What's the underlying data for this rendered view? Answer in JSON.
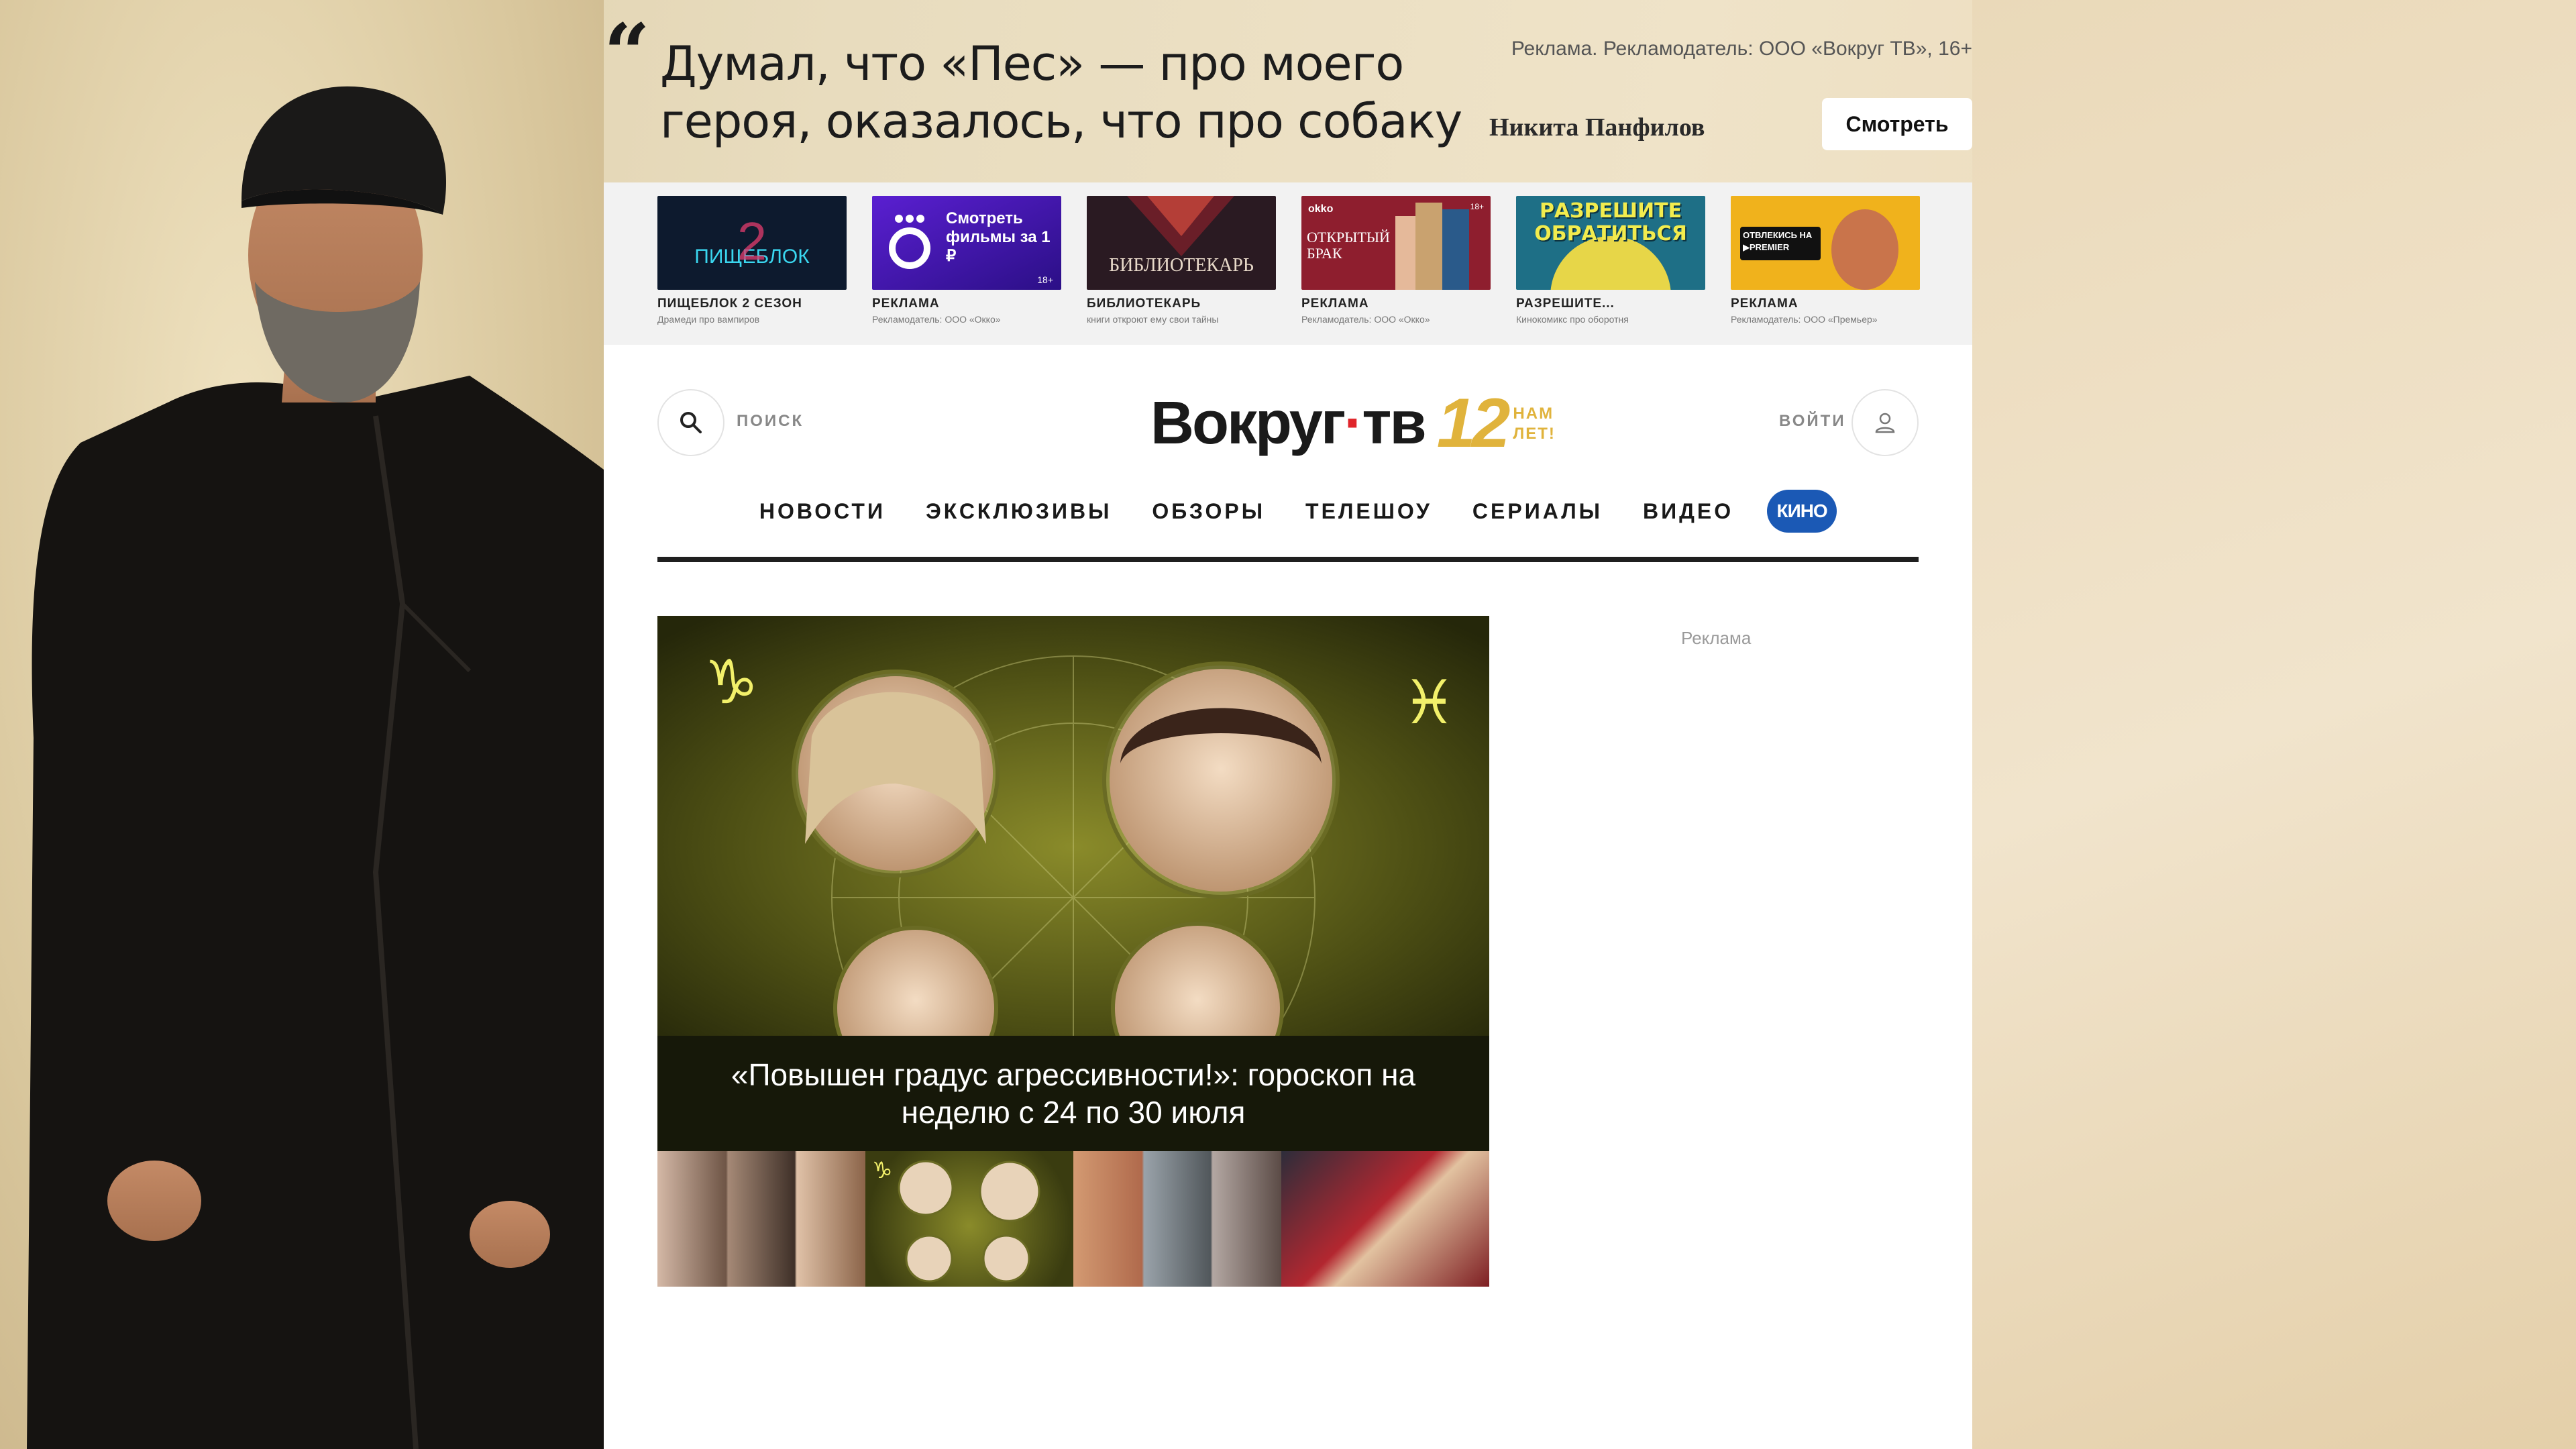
{
  "promo": {
    "quote": "Думал, что «Пес» — про моего героя, оказалось, что про собаку",
    "author": "Никита Панфилов",
    "disclaimer": "Реклама. Рекламодатель: ООО «Вокруг ТВ», 16+",
    "button": "Смотреть"
  },
  "ads": [
    {
      "title": "ПИЩЕБЛОК 2 СЕЗОН",
      "sub": "Драмеди про вампиров",
      "thumb_text": "ПИЩЕБЛОК"
    },
    {
      "title": "РЕКЛАМА",
      "sub": "Рекламодатель: ООО «Окко»",
      "thumb_text": "Смотреть фильмы за 1 ₽",
      "badge": "18+"
    },
    {
      "title": "БИБЛИОТЕКАРЬ",
      "sub": "книги откроют ему свои тайны",
      "thumb_text": "БИБЛИОТЕКАРЬ"
    },
    {
      "title": "РЕКЛАМА",
      "sub": "Рекламодатель: ООО «Окко»",
      "thumb_text": "ОТКРЫТЫЙ БРАК",
      "brand": "okko",
      "badge": "18+"
    },
    {
      "title": "РАЗРЕШИТЕ...",
      "sub": "Кинокомикс про оборотня",
      "thumb_text": "РАЗРЕШИТЕ ОБРАТИТЬСЯ"
    },
    {
      "title": "РЕКЛАМА",
      "sub": "Рекламодатель: ООО «Премьер»",
      "thumb_text": "ОТВЛЕКИСЬ НА ▶PREMIER"
    }
  ],
  "header": {
    "search_label": "ПОИСК",
    "logo_main": "Вокруг",
    "logo_dot": "·",
    "logo_suffix": "тв",
    "anniversary_number": "12",
    "anniversary_line1": "НАМ",
    "anniversary_line2": "ЛЕТ!",
    "login_label": "ВОЙТИ"
  },
  "nav": {
    "items": [
      "НОВОСТИ",
      "ЭКСКЛЮЗИВЫ",
      "ОБЗОРЫ",
      "ТЕЛЕШОУ",
      "СЕРИАЛЫ",
      "ВИДЕО"
    ],
    "kino": "КИНО"
  },
  "hero": {
    "title": "«Повышен градус агрессивности!»: гороскоп на неделю с 24 по 30 июля"
  },
  "sidebar": {
    "ad_label": "Реклама"
  },
  "colors": {
    "accent_red": "#e0252b",
    "anniversary_gold": "#e0b33c",
    "kino_blue": "#1b59b5"
  }
}
